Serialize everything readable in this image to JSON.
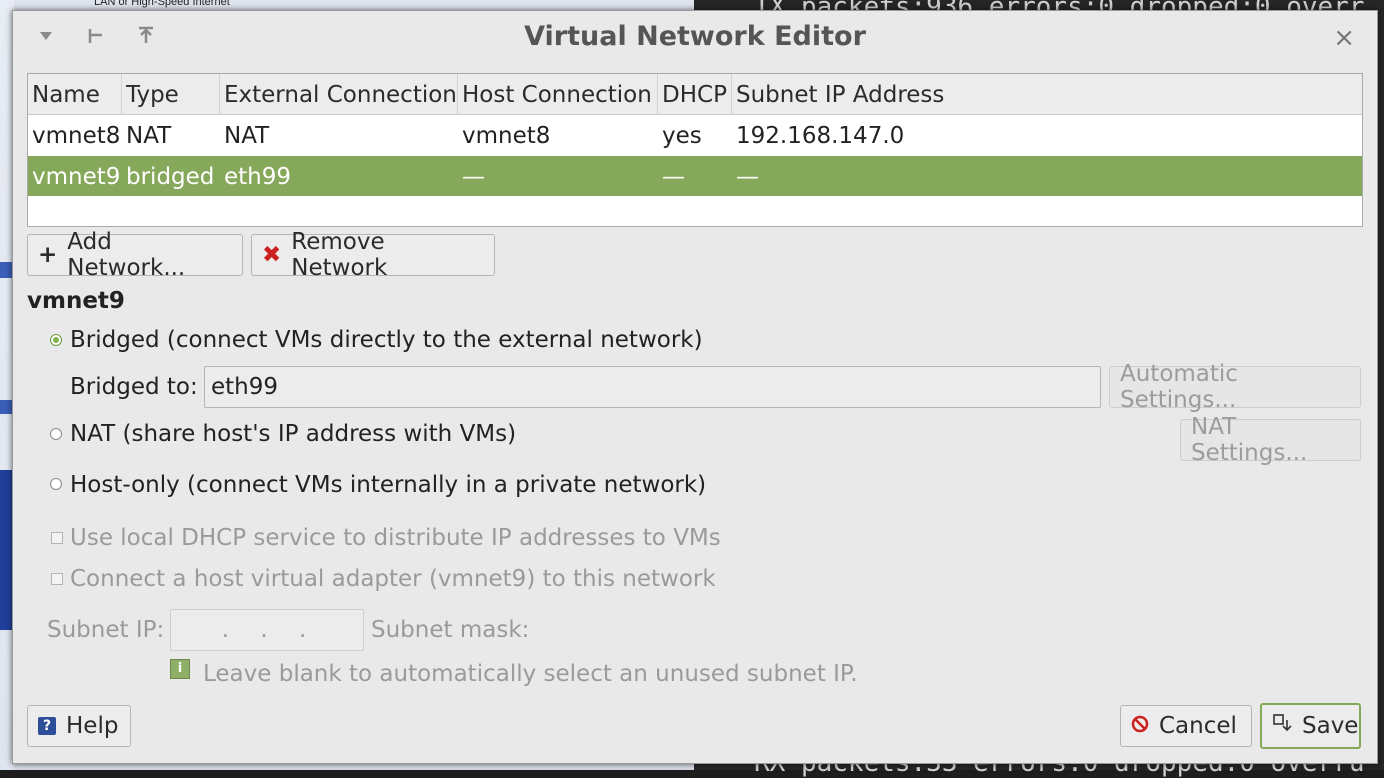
{
  "background": {
    "top_title": "LAN or High-Speed Internet",
    "terminal_line1": "TX packets:936  errors:0  dropped:0  overr",
    "terminal_line2": "RX packets:33  errors:0  dropped:0  overru"
  },
  "dialog": {
    "title": "Virtual Network Editor",
    "titlebar_icons": [
      "chevron-down-icon",
      "pin-icon",
      "arrow-up-icon"
    ],
    "close": "×"
  },
  "table": {
    "columns": [
      "Name",
      "Type",
      "External Connection",
      "Host Connection",
      "DHCP",
      "Subnet IP Address"
    ],
    "rows": [
      {
        "name": "vmnet8",
        "type": "NAT",
        "external": "NAT",
        "host": "vmnet8",
        "dhcp": "yes",
        "subnet": "192.168.147.0",
        "selected": false
      },
      {
        "name": "vmnet9",
        "type": "bridged",
        "external": "eth99",
        "host": "—",
        "dhcp": "—",
        "subnet": "—",
        "selected": true
      }
    ]
  },
  "buttons": {
    "add_network": "Add Network...",
    "remove_network": "Remove Network",
    "automatic_settings": "Automatic Settings...",
    "nat_settings": "NAT Settings...",
    "help": "Help",
    "cancel": "Cancel",
    "save": "Save"
  },
  "settings": {
    "section_title": "vmnet9",
    "bridged_label": "Bridged (connect VMs directly to the external network)",
    "bridged_to_label": "Bridged to:",
    "bridged_to_value": "eth99",
    "nat_label": "NAT (share host's IP address with VMs)",
    "hostonly_label": "Host-only (connect VMs internally in a private network)",
    "dhcp_label": "Use local DHCP service to distribute IP addresses to VMs",
    "adapter_label": "Connect a host virtual adapter (vmnet9) to this network",
    "subnet_ip_label": "Subnet IP:",
    "subnet_ip_value": " .  .  .",
    "subnet_mask_label": "Subnet mask:",
    "hint": "Leave blank to automatically select an unused subnet IP.",
    "selected_mode": "bridged"
  },
  "colors": {
    "selection": "#86a85a",
    "dialog_bg": "#e9e9e9",
    "remove_icon": "#cc1f1f",
    "cancel_icon": "#cc1f1f",
    "help_icon": "#2d4f99"
  }
}
